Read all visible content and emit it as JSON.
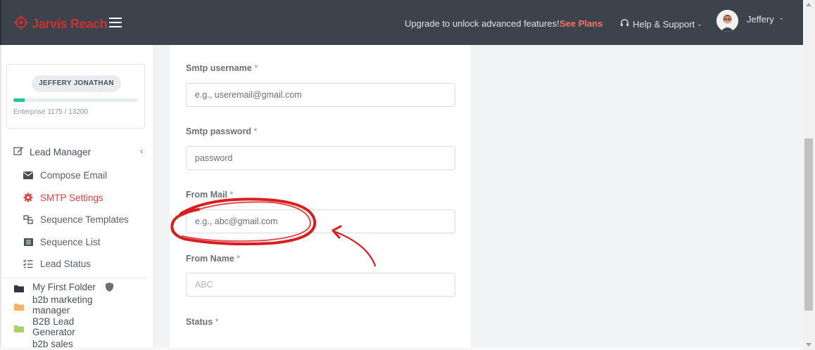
{
  "header": {
    "brand": "Jarvis Reach",
    "upgrade_text": "Upgrade to unlock advanced features!",
    "see_plans": "See Plans",
    "help": "Help & Support",
    "user_name": "Jeffery"
  },
  "sidebar": {
    "account_name": "JEFFERY JONATHAN",
    "plan_text": "Enterprise 1175 / 13200",
    "usage_fraction": 0.089,
    "menu_title": "Lead Manager",
    "items": [
      {
        "label": "Compose Email",
        "icon": "envelope-icon"
      },
      {
        "label": "SMTP Settings",
        "icon": "gear-icon",
        "active": true
      },
      {
        "label": "Sequence Templates",
        "icon": "sequence-icon"
      },
      {
        "label": "Sequence List",
        "icon": "list-icon"
      },
      {
        "label": "Lead Status",
        "icon": "checklist-icon"
      }
    ],
    "folders": [
      {
        "label": "My First Folder",
        "color": "#2f3640"
      },
      {
        "label": "b2b marketing manager",
        "color": "#f7b267"
      },
      {
        "label": "B2B Lead Generator",
        "color": "#a7d16b"
      },
      {
        "label": "b2b sales"
      }
    ]
  },
  "form": {
    "smtp_username": {
      "label": "Smtp username",
      "required": "*",
      "placeholder": "e.g., useremail@gmail.com"
    },
    "smtp_password": {
      "label": "Smtp password",
      "required": "*",
      "placeholder": "password"
    },
    "from_mail": {
      "label": "From Mail",
      "required": "*",
      "placeholder": "e.g., abc@gmail.com"
    },
    "from_name": {
      "label": "From Name",
      "required": "*",
      "placeholder": "ABC"
    },
    "status": {
      "label": "Status",
      "required": "*"
    }
  },
  "colors": {
    "topbar": "#3b434c",
    "accent_red": "#e03e3e",
    "see_plans": "#ff6f61",
    "progress": "#20c997",
    "annotation": "#d81e1e"
  }
}
